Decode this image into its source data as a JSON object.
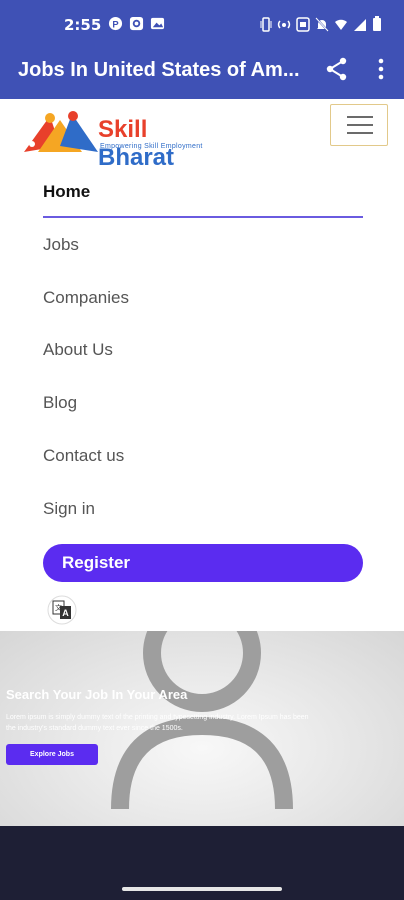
{
  "status_bar": {
    "time": "2:55"
  },
  "app_bar": {
    "title": "Jobs In United States of Am..."
  },
  "header": {
    "logo_word1": "Skill",
    "logo_word2": "Bharat",
    "logo_tagline": "Empowering Skill Employment"
  },
  "nav": {
    "items": [
      "Home",
      "Jobs",
      "Companies",
      "About Us",
      "Blog",
      "Contact us",
      "Sign in"
    ],
    "active": "Home",
    "register_label": "Register"
  },
  "hero": {
    "title": "Search Your Job In Your Area",
    "text": "Lorem ipsum is simply dummy text of the printing and typesetting industry. Lorem Ipsum has been the industry's standard dummy text ever since the 1500s.",
    "button_label": "Explore Jobs"
  },
  "colors": {
    "app_bar": "#3f51b5",
    "accent": "#5b2cf0",
    "nav_underline": "#6a5be0",
    "footer": "#1e1f35"
  }
}
